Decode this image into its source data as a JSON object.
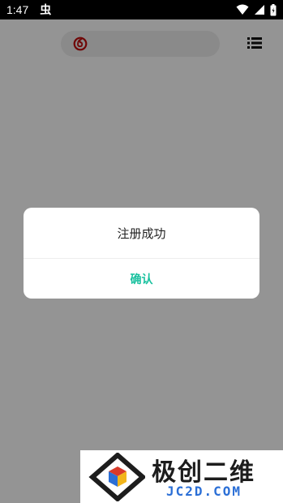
{
  "status_bar": {
    "time": "1:47",
    "notification_glyph": "虫",
    "icons": [
      "wifi-icon",
      "signal-icon",
      "battery-icon"
    ]
  },
  "app_bar": {
    "logo_icon": "netease-music-logo",
    "menu_icon": "list-menu-icon"
  },
  "dialog": {
    "title": "注册成功",
    "confirm_label": "确认"
  },
  "watermark": {
    "title": "极创二维",
    "url": "JC2D.COM"
  },
  "colors": {
    "accent": "#19c19f",
    "brand_red": "#c20c0c",
    "overlay": "rgba(0,0,0,0.42)"
  }
}
